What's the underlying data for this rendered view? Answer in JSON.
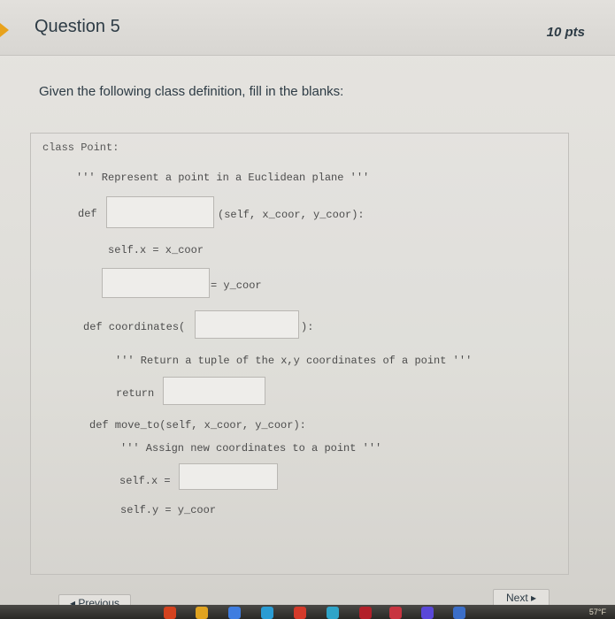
{
  "question": {
    "title": "Question 5",
    "points": "10 pts",
    "prompt": "Given the following class definition, fill in the blanks:"
  },
  "code": {
    "class_line": "class Point:",
    "docstring_class": "''' Represent a point in a Euclidean plane '''",
    "def_kw": "def",
    "init_params": "(self, x_coor, y_coor):",
    "self_x_assign": "self.x = x_coor",
    "y_coor_rhs": "= y_coor",
    "def_coordinates": "def coordinates(",
    "close_paren": "):",
    "docstring_coordinates": "''' Return a tuple of the x,y coordinates of a point '''",
    "return_kw": "return",
    "def_move_to": "def move_to(self, x_coor, y_coor):",
    "docstring_move_to": "''' Assign new coordinates to a point '''",
    "self_x_eq": "self.x =",
    "self_y_assign": "self.y = y_coor"
  },
  "blanks": {
    "init_name": "",
    "self_y_target": "",
    "coordinates_param": "",
    "return_value": "",
    "move_x_value": ""
  },
  "nav": {
    "previous": "◂ Previous",
    "next": "Next ▸"
  },
  "taskbar": {
    "temperature": "57°F"
  }
}
